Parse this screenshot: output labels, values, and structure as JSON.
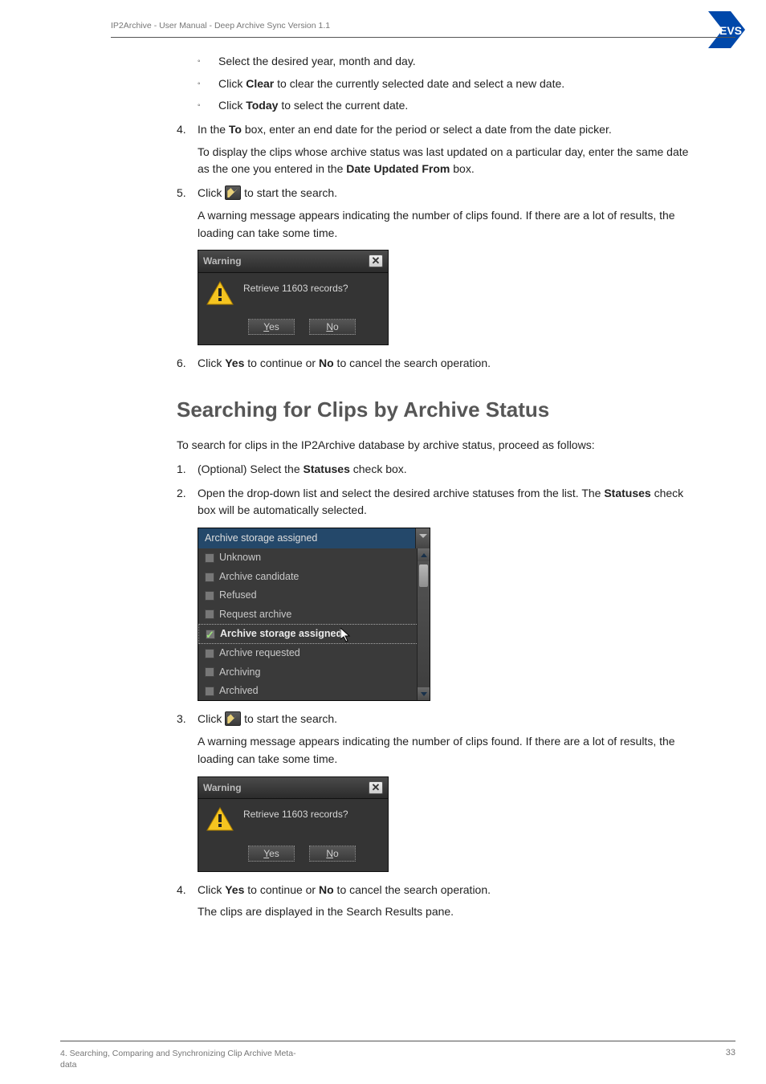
{
  "header": {
    "breadcrumb": "IP2Archive - User Manual - Deep Archive Sync Version 1.1"
  },
  "logo": {
    "text": "EVS"
  },
  "step1_sub": {
    "a": "Select the desired year, month and day.",
    "b_pre": "Click ",
    "b_bold": "Clear",
    "b_post": " to clear the currently selected date and select a new date.",
    "c_pre": "Click ",
    "c_bold": "Today",
    "c_post": " to select the current date."
  },
  "step4": {
    "num": "4.",
    "pre": "In the ",
    "bold": "To",
    "post": " box, enter an end date for the period or select a date from the date picker.",
    "para1": "To display the clips whose archive status was last updated on a particular day, enter the same date as the one you entered in the ",
    "para1_bold": "Date Updated From",
    "para1_post": " box."
  },
  "step5": {
    "num": "5.",
    "pre": "Click ",
    "post": " to start the search.",
    "para": "A warning message appears indicating the number of clips found. If there are a lot of results, the loading can take some time."
  },
  "dialog": {
    "title": "Warning",
    "msg": "Retrieve 11603 records?",
    "yes_u": "Y",
    "yes_r": "es",
    "no_u": "N",
    "no_r": "o"
  },
  "step6": {
    "num": "6.",
    "pre": "Click ",
    "b1": "Yes",
    "mid": " to continue or ",
    "b2": "No",
    "post": " to cancel the search operation."
  },
  "section": {
    "heading": "Searching for Clips by Archive Status",
    "intro": "To search for clips in the IP2Archive database by archive status, proceed as follows:"
  },
  "sstep1": {
    "num": "1.",
    "pre": "(Optional) Select the ",
    "bold": "Statuses",
    "post": " check box."
  },
  "sstep2": {
    "num": "2.",
    "text": "Open the drop-down list and select the desired archive statuses from the list. The ",
    "bold": "Statuses",
    "post": " check box will be automatically selected."
  },
  "dropdown": {
    "head": "Archive storage assigned",
    "items": {
      "unknown": "Unknown",
      "cand": "Archive candidate",
      "refused": "Refused",
      "reqarch": "Request archive",
      "assigned": "Archive storage assigned",
      "archreq": "Archive requested",
      "archiving": "Archiving",
      "archived": "Archived"
    }
  },
  "sstep3": {
    "num": "3.",
    "pre": "Click ",
    "post": " to start the search.",
    "para": "A warning message appears indicating the number of clips found. If there are a lot of results, the loading can take some time."
  },
  "sstep4": {
    "num": "4.",
    "pre": "Click ",
    "b1": "Yes",
    "mid": " to continue or ",
    "b2": "No",
    "post": " to cancel the search operation.",
    "para": "The clips are displayed in the Search Results pane."
  },
  "footer": {
    "left1": "4. Searching, Comparing and Synchronizing Clip Archive Meta-",
    "left2": "data",
    "page": "33"
  }
}
